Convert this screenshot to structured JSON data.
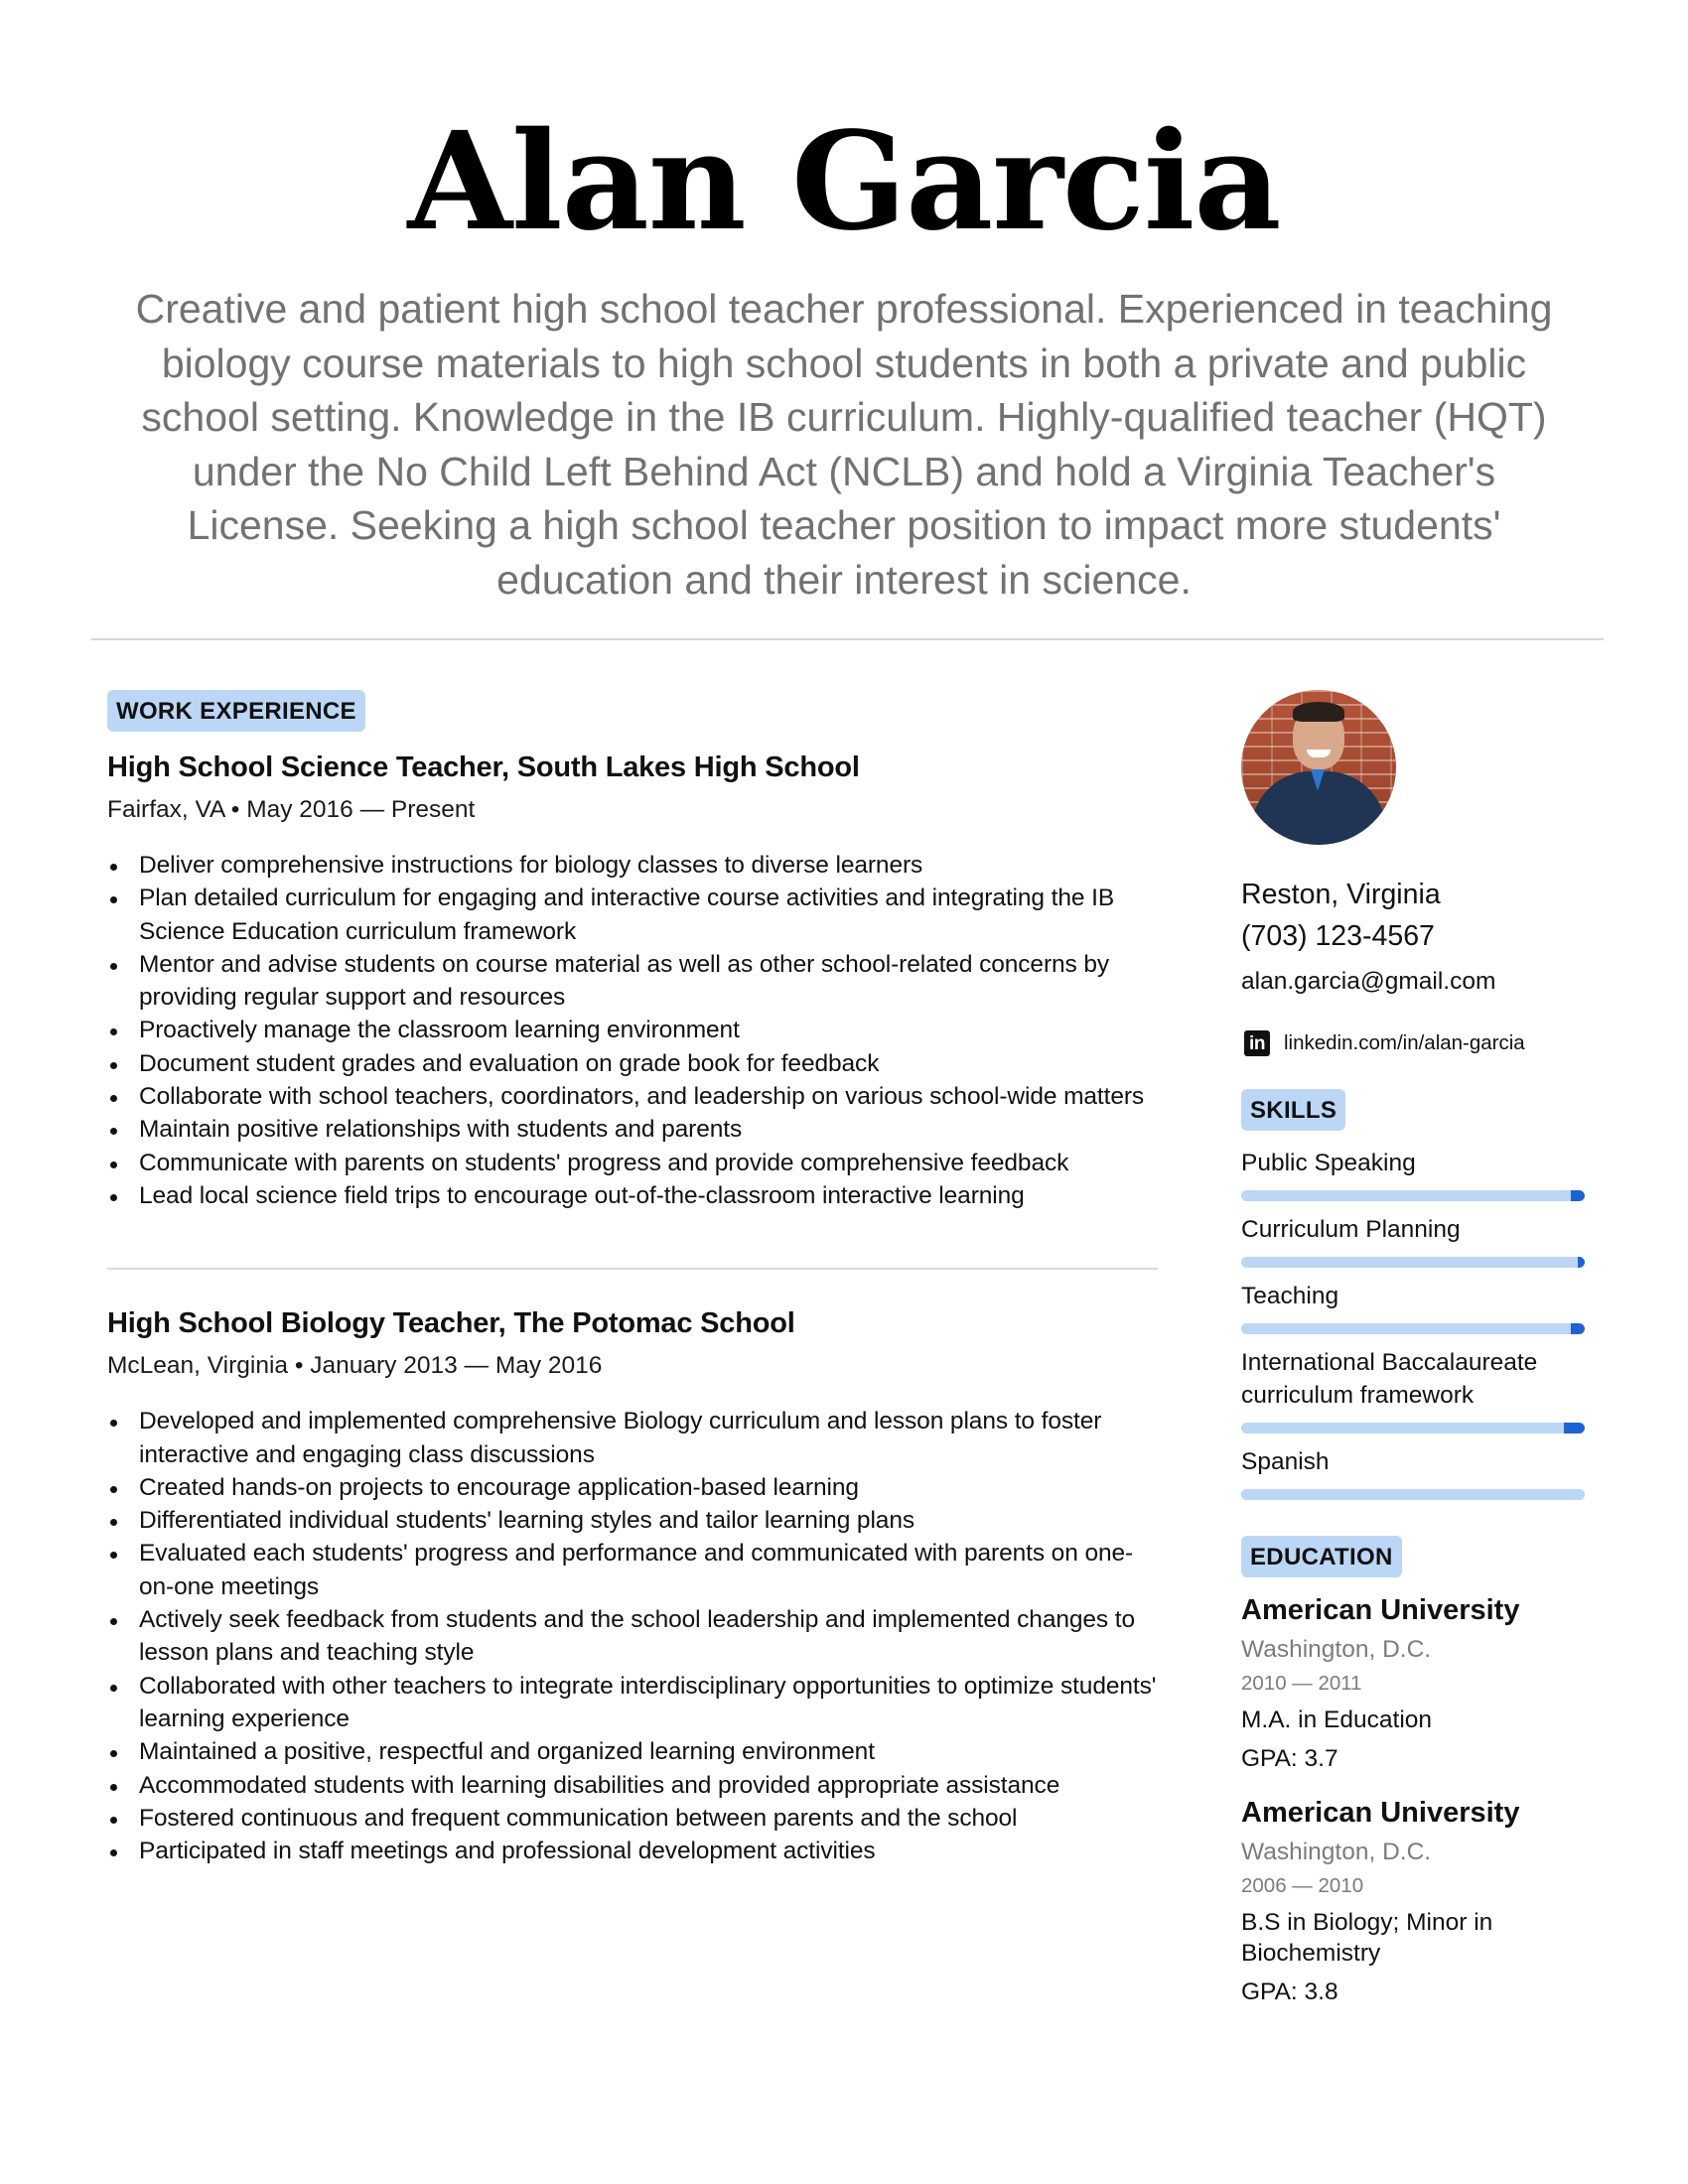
{
  "header": {
    "name": "Alan Garcia",
    "summary": "Creative and patient high school teacher professional. Experienced in teaching biology course materials to high school students in both a private and public school setting. Knowledge in the IB curriculum. Highly-qualified teacher (HQT) under the No Child Left Behind Act (NCLB) and hold a Virginia Teacher's License. Seeking a high school teacher position to impact more students' education and their interest in science."
  },
  "colors": {
    "badge_bg": "#bcd6f6",
    "skill_track": "#bcd6f6",
    "skill_accent": "#1d63d1",
    "muted_text": "#7c7c7c",
    "summary_text": "#727272"
  },
  "work": {
    "heading": "WORK EXPERIENCE",
    "jobs": [
      {
        "title": "High School Science Teacher, South Lakes High School",
        "meta": "Fairfax, VA • May 2016 — Present",
        "bullets": [
          "Deliver comprehensive instructions for biology classes to diverse learners",
          "Plan detailed curriculum for engaging and interactive course activities and integrating the IB Science Education curriculum framework",
          "Mentor and advise students on course material as well as other school-related concerns by providing regular support and resources",
          "Proactively manage the classroom learning environment",
          "Document student grades and evaluation on grade book for feedback",
          "Collaborate with school teachers, coordinators, and leadership on various school-wide matters",
          "Maintain positive relationships with students and parents",
          "Communicate with parents on students' progress and provide comprehensive feedback",
          "Lead local science field trips to encourage out-of-the-classroom interactive learning"
        ]
      },
      {
        "title": "High School Biology Teacher, The Potomac School",
        "meta": "McLean, Virginia • January 2013 — May 2016",
        "bullets": [
          "Developed and implemented comprehensive Biology curriculum and lesson plans to foster interactive and engaging class discussions",
          "Created hands-on projects to encourage application-based learning",
          "Differentiated individual students' learning styles and tailor learning plans",
          "Evaluated each students' progress and performance and communicated with parents on one-on-one meetings",
          "Actively seek feedback from students and the school leadership and implemented changes to lesson plans and teaching style",
          "Collaborated with other teachers to integrate interdisciplinary opportunities to optimize students' learning experience",
          "Maintained a positive, respectful and organized learning environment",
          "Accommodated students with learning disabilities and provided appropriate assistance",
          "Fostered continuous and frequent communication between parents and the school",
          "Participated in staff meetings and professional development activities"
        ]
      }
    ]
  },
  "contact": {
    "avatar_icon": "profile-photo",
    "city": "Reston, Virginia",
    "phone": "(703) 123-4567",
    "email": "alan.garcia@gmail.com",
    "linkedin_icon": "linkedin-icon",
    "linkedin_glyph": "in",
    "linkedin": "linkedin.com/in/alan-garcia"
  },
  "skills": {
    "heading": "SKILLS",
    "items": [
      {
        "name": "Public Speaking",
        "level": 0.96
      },
      {
        "name": "Curriculum Planning",
        "level": 0.98
      },
      {
        "name": "Teaching",
        "level": 0.96
      },
      {
        "name": "International Baccalaureate curriculum framework",
        "level": 0.94
      },
      {
        "name": "Spanish",
        "level": 1.0
      }
    ]
  },
  "education": {
    "heading": "EDUCATION",
    "items": [
      {
        "school": "American University",
        "location": "Washington, D.C.",
        "years": "2010 — 2011",
        "degree": "M.A. in Education",
        "gpa": "GPA: 3.7"
      },
      {
        "school": "American University",
        "location": "Washington, D.C.",
        "years": "2006 — 2010",
        "degree": "B.S in Biology; Minor in Biochemistry",
        "gpa": "GPA: 3.8"
      }
    ]
  }
}
